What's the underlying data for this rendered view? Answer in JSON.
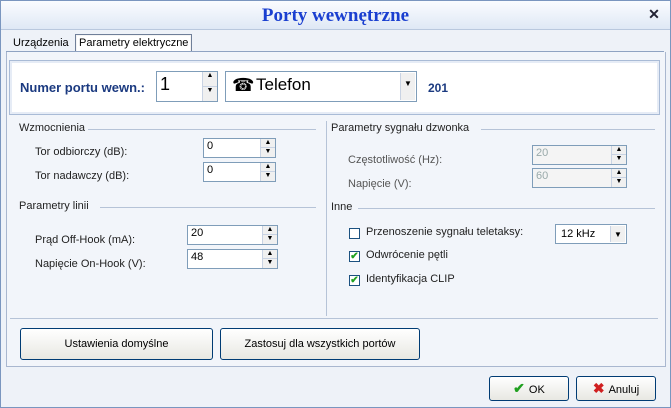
{
  "window": {
    "title": "Porty wewnętrzne"
  },
  "tabs": [
    {
      "label": "Urządzenia"
    },
    {
      "label": "Parametry elektryczne"
    }
  ],
  "port": {
    "label": "Numer portu wewn.:",
    "number": "1",
    "type": "Telefon",
    "extension": "201"
  },
  "gains": {
    "title": "Wzmocnienia",
    "rx_label": "Tor odbiorczy (dB):",
    "rx_value": "0",
    "tx_label": "Tor nadawczy (dB):",
    "tx_value": "0"
  },
  "line": {
    "title": "Parametry linii",
    "offhook_label": "Prąd Off-Hook (mA):",
    "offhook_value": "20",
    "onhook_label": "Napięcie On-Hook (V):",
    "onhook_value": "48"
  },
  "ring": {
    "title": "Parametry sygnału dzwonka",
    "freq_label": "Częstotliwość (Hz):",
    "freq_value": "20",
    "volt_label": "Napięcie (V):",
    "volt_value": "60"
  },
  "other": {
    "title": "Inne",
    "teletax_label": "Przenoszenie sygnału teletaksy:",
    "teletax_checked": false,
    "teletax_freq": "12 kHz",
    "reversal_label": "Odwrócenie pętli",
    "reversal_checked": true,
    "clip_label": "Identyfikacja CLIP",
    "clip_checked": true
  },
  "buttons": {
    "defaults": "Ustawienia domyślne",
    "apply_all": "Zastosuj dla wszystkich portów",
    "ok": "OK",
    "cancel": "Anuluj"
  },
  "icons": {
    "close": "close-icon",
    "phone": "phone-icon",
    "ok": "check-icon",
    "cancel": "x-icon"
  },
  "colors": {
    "title": "#1a3fd0",
    "accent_label": "#1b3a80"
  }
}
